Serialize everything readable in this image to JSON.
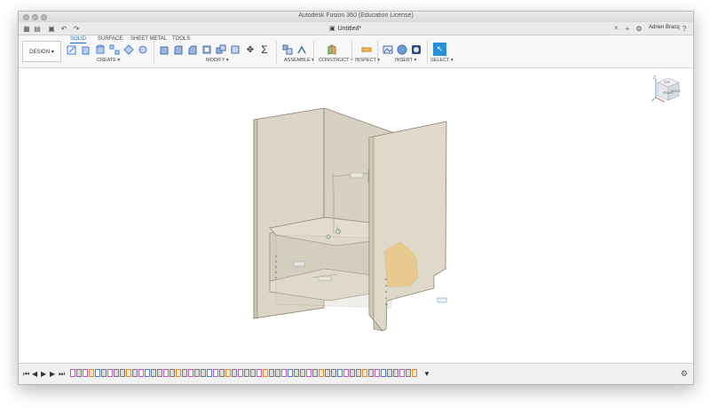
{
  "window": {
    "title": "Autodesk Fusion 360 (Education License)"
  },
  "tabbar": {
    "document_title": "Untitled*",
    "user_name": "Adrien Bracq"
  },
  "toolbar": {
    "workspace": "DESIGN ▾",
    "tabs": [
      "SOLID",
      "SURFACE",
      "SHEET METAL",
      "TOOLS"
    ],
    "groups": {
      "create": "CREATE ▾",
      "modify": "MODIFY ▾",
      "assemble": "ASSEMBLE ▾",
      "construct": "CONSTRUCT ▾",
      "inspect": "INSPECT ▾",
      "insert": "INSERT ▾",
      "select": "SELECT ▾"
    }
  },
  "viewcube": {
    "top": "TOP",
    "front": "FRONT",
    "right": "RIGHT",
    "axis_z": "Z"
  },
  "icons": {
    "grid": "grid-icon",
    "file": "file-icon",
    "save": "save-icon",
    "undo": "undo-icon",
    "redo": "redo-icon",
    "add_tab": "plus-icon",
    "extensions": "gear-icon",
    "help": "help-icon",
    "settings": "gear-icon"
  },
  "colors": {
    "accent": "#1a73c8",
    "select_tool": "#2a8fd9",
    "model": "#d9d3c3",
    "model_edge": "#8a8270",
    "highlight": "#f1bf64"
  }
}
